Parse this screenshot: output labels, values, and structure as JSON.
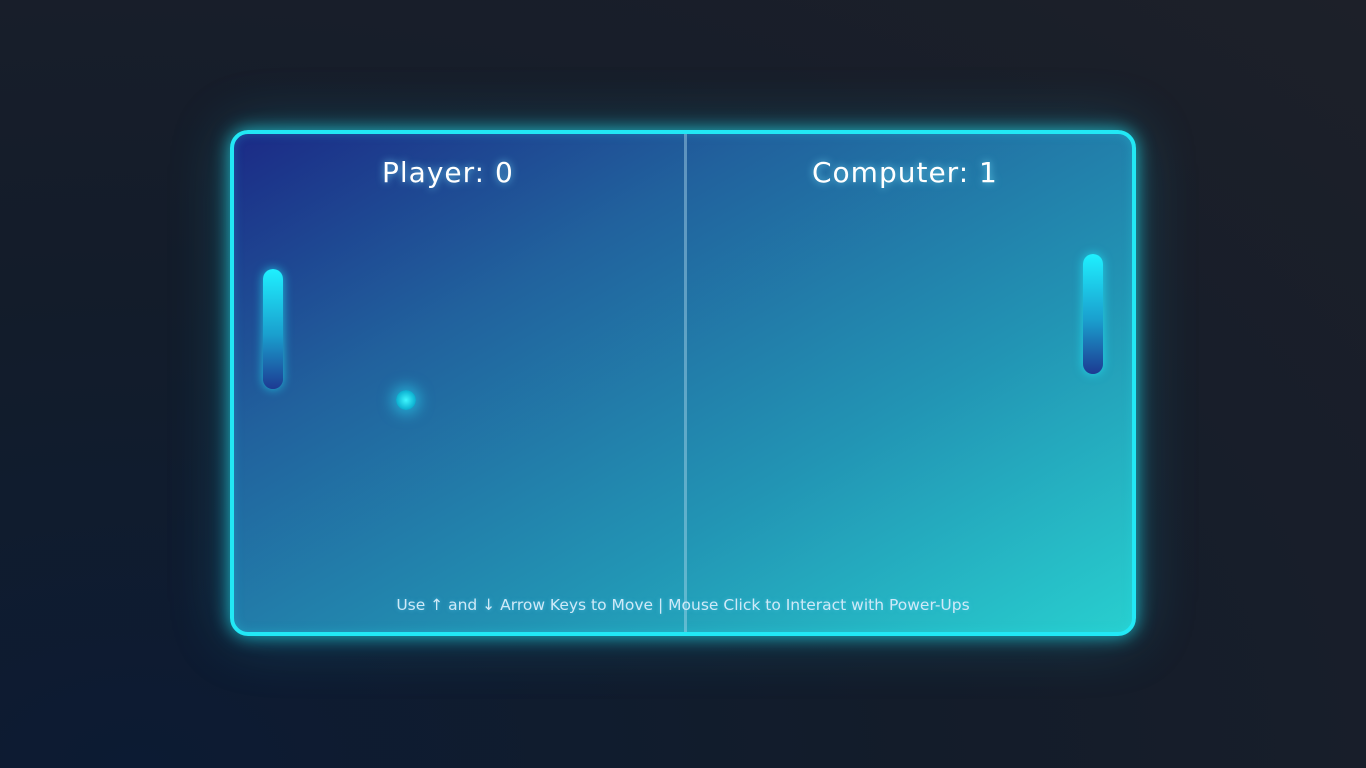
{
  "scoreboard": {
    "player": "Player: 0",
    "computer": "Computer: 1"
  },
  "instructions": "Use ↑ and ↓ Arrow Keys to Move | Mouse Click to Interact with Power-Ups",
  "colors": {
    "border": "#22e8f5",
    "field_start": "#1b2a86",
    "field_end": "#28cfcf",
    "paddle_top": "#1ff0ff",
    "paddle_bottom": "#1d3a92",
    "ball": "#3ff7ff"
  }
}
